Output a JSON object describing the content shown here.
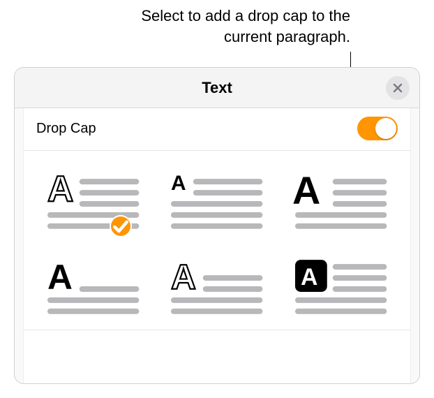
{
  "callout": {
    "text": "Select to add a drop cap to the current paragraph."
  },
  "panel": {
    "title": "Text",
    "close_icon": "close-icon"
  },
  "drop_cap": {
    "label": "Drop Cap",
    "enabled": true
  },
  "styles": {
    "options": [
      {
        "id": "dropcap-style-1",
        "selected": true
      },
      {
        "id": "dropcap-style-2",
        "selected": false
      },
      {
        "id": "dropcap-style-3",
        "selected": false
      },
      {
        "id": "dropcap-style-4",
        "selected": false
      },
      {
        "id": "dropcap-style-5",
        "selected": false
      },
      {
        "id": "dropcap-style-6",
        "selected": false
      }
    ]
  },
  "colors": {
    "accent": "#FF9500",
    "glyph": "#000000",
    "line": "#B8B8BA"
  }
}
